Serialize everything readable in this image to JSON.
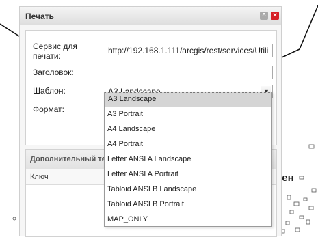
{
  "dialog": {
    "title": "Печать"
  },
  "form": {
    "service_label": "Сервис для\nпечати:",
    "service_value": "http://192.168.1.111/arcgis/rest/services/Utili",
    "title_label": "Заголовок:",
    "title_value": "",
    "template_label": "Шаблон:",
    "template_value": "A3 Landscape",
    "format_label": "Формат:"
  },
  "extra_panel": {
    "title": "Дополнительный те",
    "key_column": "Ключ"
  },
  "dropdown": {
    "options": [
      "A3 Landscape",
      "A3 Portrait",
      "A4 Landscape",
      "A4 Portrait",
      "Letter ANSI A Landscape",
      "Letter ANSI A Portrait",
      "Tabloid ANSI B Landscape",
      "Tabloid ANSI B Portrait",
      "MAP_ONLY"
    ],
    "selected_index": 0
  },
  "map": {
    "label": "ген"
  },
  "icons": {
    "collapse": "double-chevron-up-icon",
    "close": "close-icon",
    "select_arrow": "chevron-down-icon"
  },
  "colors": {
    "close_button": "#d61f26",
    "selected_option": "#d5d5d5"
  }
}
